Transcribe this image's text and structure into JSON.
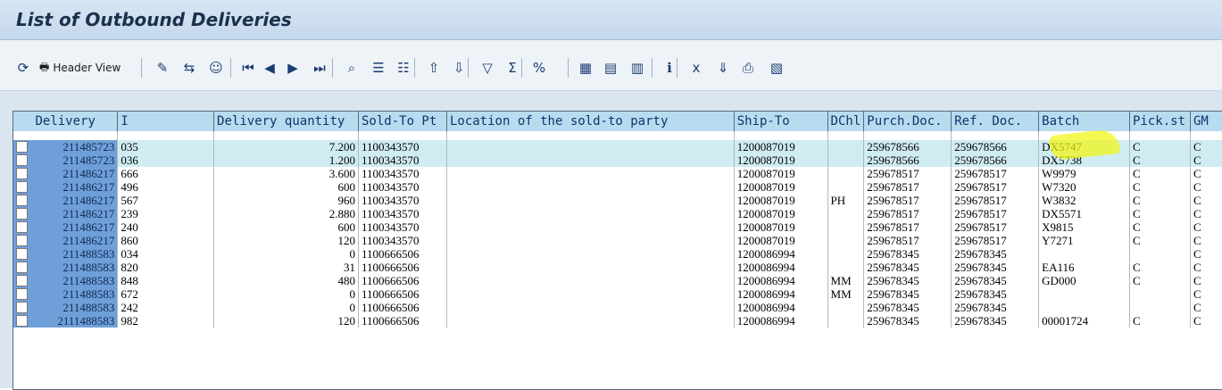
{
  "window": {
    "title": "List of Outbound Deliveries"
  },
  "toolbar": {
    "buttons": [
      {
        "name": "refresh-icon",
        "glyph": "⟳"
      },
      {
        "name": "header-view-button",
        "glyph": "🖶",
        "label": "Header View"
      },
      {
        "name": "pencil-icon",
        "glyph": "✎"
      },
      {
        "name": "goods-movement-icon",
        "glyph": "⇆"
      },
      {
        "name": "person-icon",
        "glyph": "☺"
      },
      {
        "name": "first-page-icon",
        "glyph": "⏮"
      },
      {
        "name": "previous-icon",
        "glyph": "◀"
      },
      {
        "name": "next-icon",
        "glyph": "▶"
      },
      {
        "name": "last-page-icon",
        "glyph": "⏭"
      },
      {
        "name": "find-icon",
        "glyph": "⌕"
      },
      {
        "name": "select-all-icon",
        "glyph": "☰"
      },
      {
        "name": "deselect-all-icon",
        "glyph": "☷"
      },
      {
        "name": "sort-ascending-icon",
        "glyph": "⇧"
      },
      {
        "name": "sort-descending-icon",
        "glyph": "⇩"
      },
      {
        "name": "filter-icon",
        "glyph": "▽"
      },
      {
        "name": "sum-icon",
        "glyph": "Σ"
      },
      {
        "name": "subtotal-icon",
        "glyph": "%"
      },
      {
        "name": "layout-icon",
        "glyph": "▦"
      },
      {
        "name": "change-layout-icon",
        "glyph": "▤"
      },
      {
        "name": "select-layout-icon",
        "glyph": "▥"
      },
      {
        "name": "info-icon",
        "glyph": "ℹ"
      },
      {
        "name": "export-excel-icon",
        "glyph": "x"
      },
      {
        "name": "download-icon",
        "glyph": "⇓"
      },
      {
        "name": "print-icon",
        "glyph": "⎙"
      },
      {
        "name": "abc-analysis-icon",
        "glyph": "▧"
      }
    ]
  },
  "table": {
    "columns": [
      "Delivery",
      "I",
      "Delivery quantity",
      "Sold-To Pt",
      "Location of the sold-to party",
      "Ship-To",
      "DChl",
      "Purch.Doc.",
      "Ref. Doc.",
      "Batch",
      "Pick.st",
      "GM"
    ],
    "rows": [
      {
        "delivery": "211485723",
        "item": "035",
        "qty": "7.200",
        "sold_to": "1100343570",
        "location": "",
        "ship_to": "1200087019",
        "dchl": "",
        "purch": "259678566",
        "ref": "259678566",
        "batch": "DX5747",
        "pick": "C",
        "gm": "C",
        "hl": true
      },
      {
        "delivery": "211485723",
        "item": "036",
        "qty": "1.200",
        "sold_to": "1100343570",
        "location": "",
        "ship_to": "1200087019",
        "dchl": "",
        "purch": "259678566",
        "ref": "259678566",
        "batch": "DX5738",
        "pick": "C",
        "gm": "C",
        "hl": true
      },
      {
        "delivery": "211486217",
        "item": "666",
        "qty": "3.600",
        "sold_to": "1100343570",
        "location": "",
        "ship_to": "1200087019",
        "dchl": "",
        "purch": "259678517",
        "ref": "259678517",
        "batch": "W9979",
        "pick": "C",
        "gm": "C",
        "hl": false
      },
      {
        "delivery": "211486217",
        "item": "496",
        "qty": "600",
        "sold_to": "1100343570",
        "location": "",
        "ship_to": "1200087019",
        "dchl": "",
        "purch": "259678517",
        "ref": "259678517",
        "batch": "W7320",
        "pick": "C",
        "gm": "C",
        "hl": false
      },
      {
        "delivery": "211486217",
        "item": "567",
        "qty": "960",
        "sold_to": "1100343570",
        "location": "",
        "ship_to": "1200087019",
        "dchl": "PH",
        "purch": "259678517",
        "ref": "259678517",
        "batch": "W3832",
        "pick": "C",
        "gm": "C",
        "hl": false
      },
      {
        "delivery": "211486217",
        "item": "239",
        "qty": "2.880",
        "sold_to": "1100343570",
        "location": "",
        "ship_to": "1200087019",
        "dchl": "",
        "purch": "259678517",
        "ref": "259678517",
        "batch": "DX5571",
        "pick": "C",
        "gm": "C",
        "hl": false
      },
      {
        "delivery": "211486217",
        "item": "240",
        "qty": "600",
        "sold_to": "1100343570",
        "location": "",
        "ship_to": "1200087019",
        "dchl": "",
        "purch": "259678517",
        "ref": "259678517",
        "batch": "X9815",
        "pick": "C",
        "gm": "C",
        "hl": false
      },
      {
        "delivery": "211486217",
        "item": "860",
        "qty": "120",
        "sold_to": "1100343570",
        "location": "",
        "ship_to": "1200087019",
        "dchl": "",
        "purch": "259678517",
        "ref": "259678517",
        "batch": "Y7271",
        "pick": "C",
        "gm": "C",
        "hl": false
      },
      {
        "delivery": "211488583",
        "item": "034",
        "qty": "0",
        "sold_to": "1100666506",
        "location": "",
        "ship_to": "1200086994",
        "dchl": "",
        "purch": "259678345",
        "ref": "259678345",
        "batch": "",
        "pick": "",
        "gm": "C",
        "hl": false
      },
      {
        "delivery": "211488583",
        "item": "820",
        "qty": "31",
        "sold_to": "1100666506",
        "location": "",
        "ship_to": "1200086994",
        "dchl": "",
        "purch": "259678345",
        "ref": "259678345",
        "batch": "EA116",
        "pick": "C",
        "gm": "C",
        "hl": false
      },
      {
        "delivery": "211488583",
        "item": "848",
        "qty": "480",
        "sold_to": "1100666506",
        "location": "",
        "ship_to": "1200086994",
        "dchl": "MM",
        "purch": "259678345",
        "ref": "259678345",
        "batch": "GD000",
        "pick": "C",
        "gm": "C",
        "hl": false
      },
      {
        "delivery": "211488583",
        "item": "672",
        "qty": "0",
        "sold_to": "1100666506",
        "location": "",
        "ship_to": "1200086994",
        "dchl": "MM",
        "purch": "259678345",
        "ref": "259678345",
        "batch": "",
        "pick": "",
        "gm": "C",
        "hl": false
      },
      {
        "delivery": "211488583",
        "item": "242",
        "qty": "0",
        "sold_to": "1100666506",
        "location": "",
        "ship_to": "1200086994",
        "dchl": "",
        "purch": "259678345",
        "ref": "259678345",
        "batch": "",
        "pick": "",
        "gm": "C",
        "hl": false
      },
      {
        "delivery": "2111488583",
        "item": "982",
        "qty": "120",
        "sold_to": "1100666506",
        "location": "",
        "ship_to": "1200086994",
        "dchl": "",
        "purch": "259678345",
        "ref": "259678345",
        "batch": "00001724",
        "pick": "C",
        "gm": "C",
        "hl": false
      }
    ]
  }
}
